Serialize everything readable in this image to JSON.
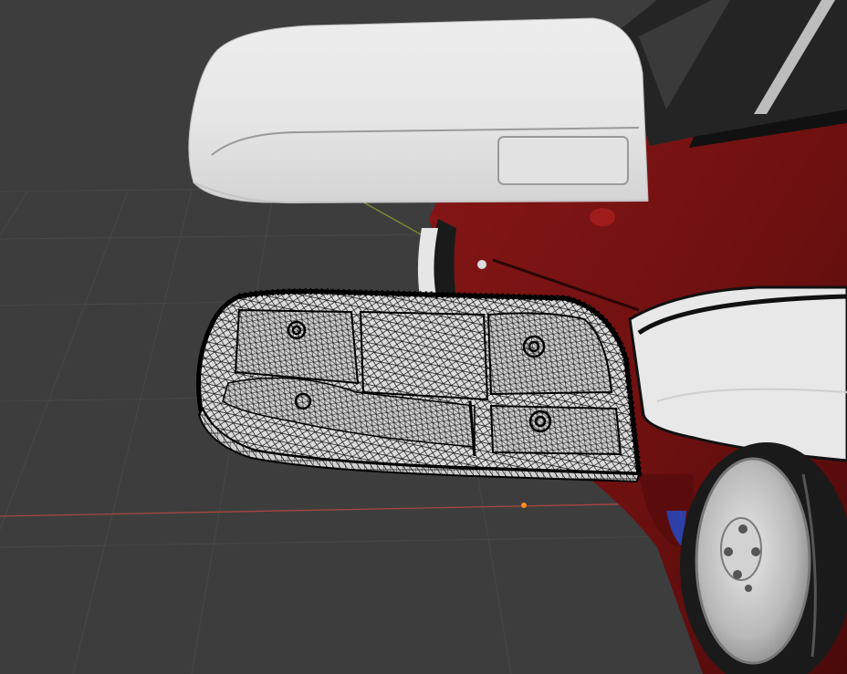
{
  "viewport": {
    "label": "3D Viewport",
    "background": "#3d3d3d",
    "grid_color": "#4a4a4a",
    "x_axis_color": "#b4473f",
    "y_axis_color": "#8fa33a",
    "origin_color": "#ff8c1a"
  },
  "scene": {
    "mirror_cover_color": "#e4e4e4",
    "wireframe_color": "#000000",
    "car_body_color": "#7a1414",
    "glass_color": "#262626",
    "wheel_color": "#c8c8c8",
    "tire_color": "#1a1a1a",
    "accent_blue": "#2e3fa8"
  }
}
